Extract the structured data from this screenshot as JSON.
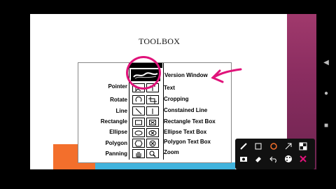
{
  "slide": {
    "title": "TOOLBOX"
  },
  "toolbox": {
    "left_labels": [
      "Pointer",
      "Rotate",
      "Line",
      "Rectangle",
      "Ellipse",
      "Polygon",
      "Panning"
    ],
    "right_labels": [
      "Version Window",
      "Text",
      "Cropping",
      "Constained Line",
      "Rectangle Text Box",
      "Ellipse Text Box",
      "Polygon Text Box",
      "Zoom"
    ]
  },
  "icons": {
    "pointer": "pointer-icon",
    "text": "text-icon",
    "rotate": "rotate-icon",
    "crop": "crop-icon",
    "line": "line-icon",
    "constrained_line": "constrained-line-icon",
    "rectangle": "rectangle-icon",
    "rect_text": "rectangle-text-icon",
    "ellipse": "ellipse-icon",
    "ellipse_text": "ellipse-text-icon",
    "polygon": "polygon-icon",
    "polygon_text": "polygon-text-icon",
    "pan": "pan-icon",
    "zoom": "zoom-icon"
  },
  "annotation": {
    "circle_color": "#e0137a"
  },
  "colors": {
    "purple": "#8a2d60",
    "orange": "#f36f2c",
    "blue": "#41b3dd"
  }
}
